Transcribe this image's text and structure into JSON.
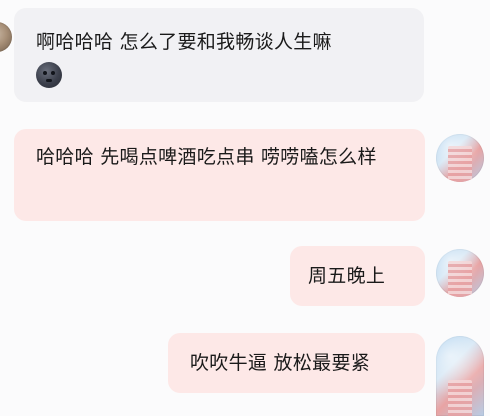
{
  "chat": {
    "messages": [
      {
        "side": "left",
        "text": "啊哈哈哈 怎么了要和我畅谈人生嘛",
        "has_emoji": true,
        "emoji_name": "dark-moon-face-emoji"
      },
      {
        "side": "right",
        "text": "哈哈哈 先喝点啤酒吃点串 唠唠嗑怎么样"
      },
      {
        "side": "right",
        "text": "周五晚上"
      },
      {
        "side": "right",
        "text": "吹吹牛逼 放松最要紧"
      }
    ],
    "colors": {
      "incoming_bubble": "#f1f1f4",
      "outgoing_bubble": "#fde8e7",
      "background": "#fbfbfc"
    }
  }
}
